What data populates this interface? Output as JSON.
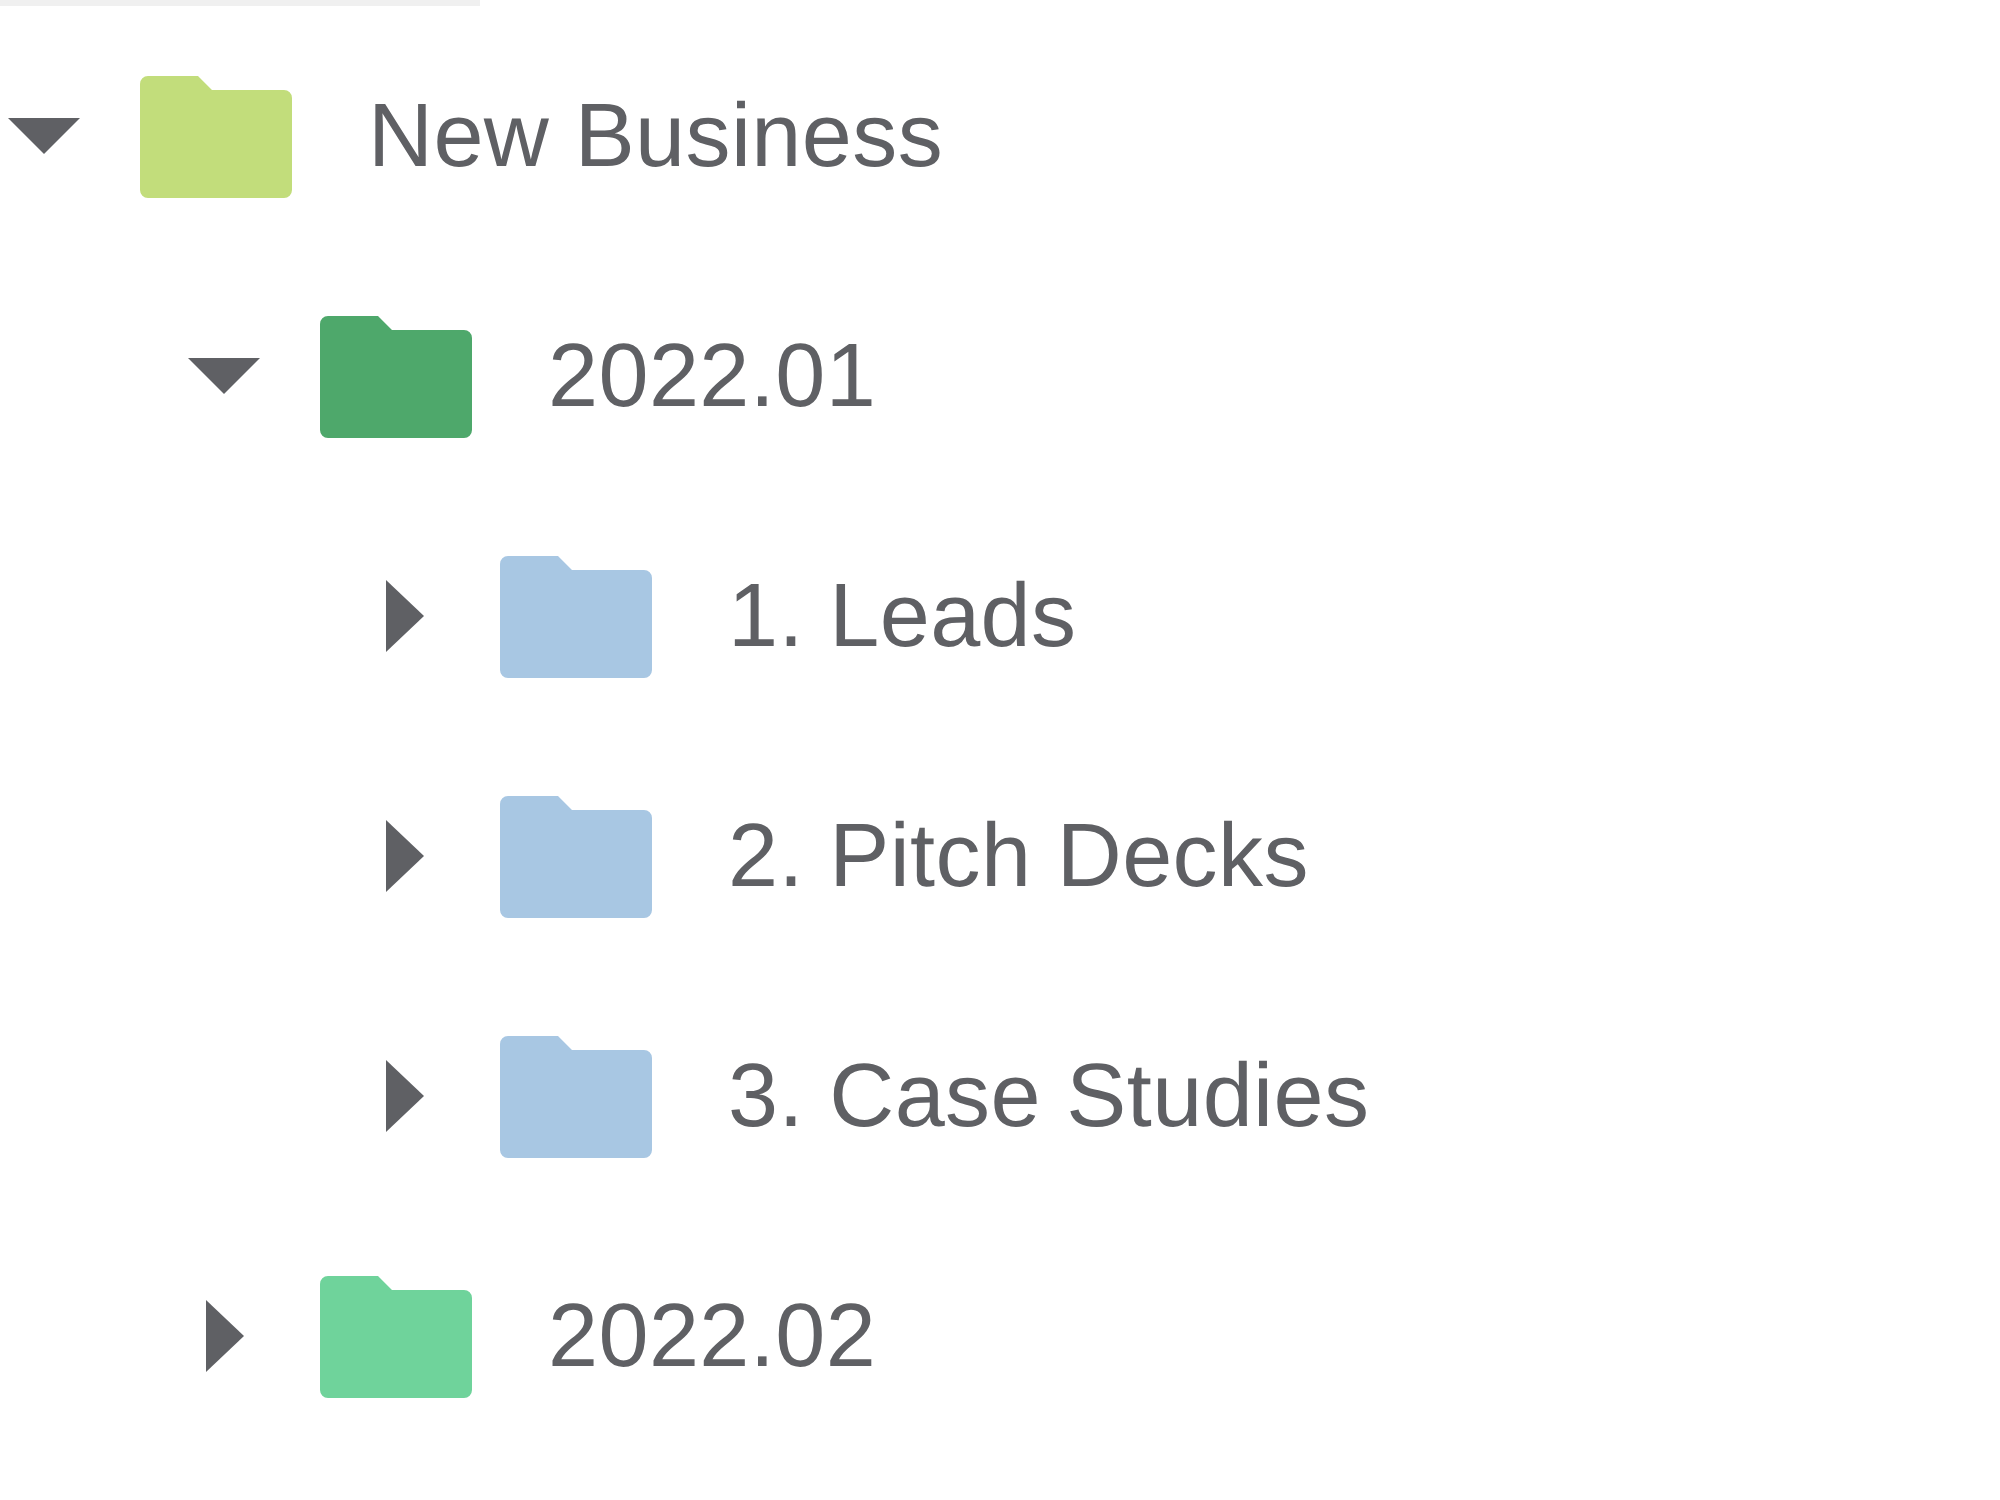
{
  "tree": [
    {
      "label": "New Business",
      "color": "#c2dd7b",
      "expanded": true,
      "children": [
        {
          "label": "2022.01",
          "color": "#4ea86b",
          "expanded": true,
          "children": [
            {
              "label": "1. Leads",
              "color": "#a8c7e3",
              "expanded": false
            },
            {
              "label": "2. Pitch Decks",
              "color": "#a8c7e3",
              "expanded": false
            },
            {
              "label": "3. Case Studies",
              "color": "#a8c7e3",
              "expanded": false
            }
          ]
        },
        {
          "label": "2022.02",
          "color": "#6fd39b",
          "expanded": false
        }
      ]
    }
  ]
}
